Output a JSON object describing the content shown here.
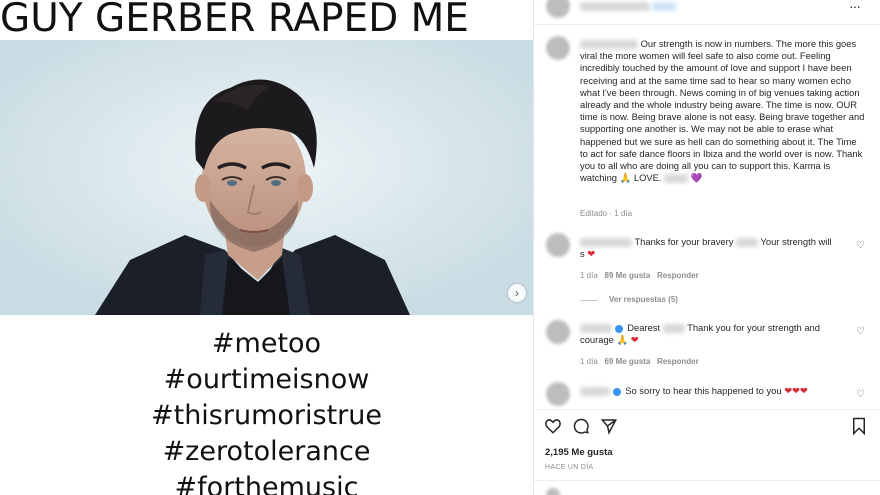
{
  "post": {
    "headline": "GUY GERBER RAPED ME",
    "hashtags": [
      "#metoo",
      "#ourtimeisnow",
      "#thisrumoristrue",
      "#zerotolerance",
      "#forthemusic"
    ],
    "next_icon": "chevron-right-icon"
  },
  "header": {
    "more_icon": "more-horizontal-icon",
    "more_label": "···"
  },
  "caption": {
    "text": "Our strength is now in numbers. The more this goes viral the more women will feel safe to also come out. Feeling incredibly touched by the amount of love and support I have been receiving and at the same time sad to hear so many women echo what I've been through. News coming in of big venues taking action already and the whole industry being aware. The time is now. OUR time is now. Being brave alone is not easy. Being brave together and supporting one another is. We may not be able to erase what happened but we sure as hell can do something about it. The Time to act for safe dance floors in Ibiza and the world over is now. Thank you to all who are doing all you can to support this. Karma is watching",
    "emoji_pray": "🙏",
    "end_text": "LOVE.",
    "heart": "💜",
    "meta": "Editado · 1 día"
  },
  "comments": [
    {
      "text_a": "Thanks for your bravery",
      "text_b": "Your strength will",
      "text_c": "s",
      "heart": "❤",
      "time": "1 día",
      "likes": "89 Me gusta",
      "reply": "Responder",
      "view_replies": "Ver respuestas (5)"
    },
    {
      "text_a": "Dearest",
      "text_b": "Thank you for your strength and",
      "text_c": "courage",
      "emoji": "🙏",
      "heart": "❤",
      "time": "1 día",
      "likes": "69 Me gusta",
      "reply": "Responder"
    },
    {
      "text_a": "So sorry to hear this happened to you",
      "hearts": "❤❤❤"
    }
  ],
  "actions": {
    "like_icon": "heart-icon",
    "comment_icon": "comment-icon",
    "share_icon": "send-icon",
    "save_icon": "bookmark-icon",
    "likes": "2,195 Me gusta",
    "time_ago": "HACE UN DÍA"
  }
}
